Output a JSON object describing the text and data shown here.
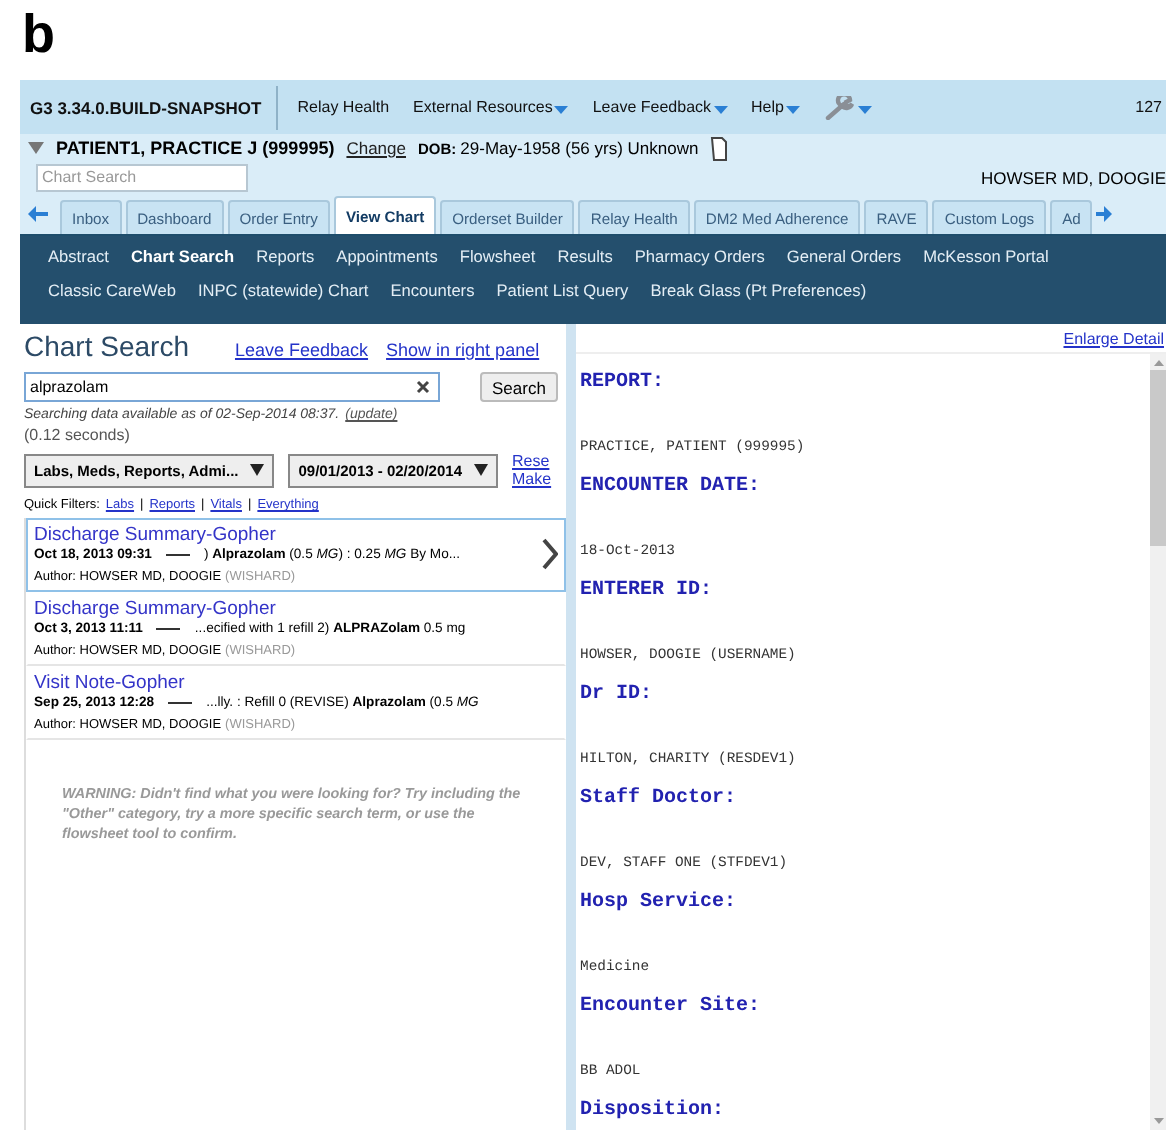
{
  "figure_label": "b",
  "toolbar": {
    "version": "G3 3.34.0.BUILD-SNAPSHOT",
    "menus": [
      {
        "label": "Relay Health",
        "dropdown": false
      },
      {
        "label": "External Resources",
        "dropdown": true
      },
      {
        "label": "Leave Feedback",
        "dropdown": true
      },
      {
        "label": "Help",
        "dropdown": true
      }
    ],
    "right_text": "127"
  },
  "patient": {
    "name": "PATIENT1, PRACTICE J (999995)",
    "change_link": "Change",
    "dob_label": "DOB:",
    "dob": "29-May-1958 (56 yrs) Unknown",
    "chart_search_placeholder": "Chart Search",
    "provider": "HOWSER MD, DOOGIE"
  },
  "tabs": [
    {
      "label": "Inbox",
      "selected": false
    },
    {
      "label": "Dashboard",
      "selected": false
    },
    {
      "label": "Order Entry",
      "selected": false
    },
    {
      "label": "View Chart",
      "selected": true
    },
    {
      "label": "Orderset Builder",
      "selected": false
    },
    {
      "label": "Relay Health",
      "selected": false
    },
    {
      "label": "DM2 Med Adherence",
      "selected": false
    },
    {
      "label": "RAVE",
      "selected": false
    },
    {
      "label": "Custom Logs",
      "selected": false
    },
    {
      "label": "Ad",
      "selected": false
    }
  ],
  "nav_rows": [
    [
      {
        "label": "Abstract",
        "selected": false
      },
      {
        "label": "Chart Search",
        "selected": true
      },
      {
        "label": "Reports",
        "selected": false
      },
      {
        "label": "Appointments",
        "selected": false
      },
      {
        "label": "Flowsheet",
        "selected": false
      },
      {
        "label": "Results",
        "selected": false
      },
      {
        "label": "Pharmacy Orders",
        "selected": false
      },
      {
        "label": "General Orders",
        "selected": false
      },
      {
        "label": "McKesson Portal",
        "selected": false
      }
    ],
    [
      {
        "label": "Classic CareWeb",
        "selected": false
      },
      {
        "label": "INPC (statewide) Chart",
        "selected": false
      },
      {
        "label": "Encounters",
        "selected": false
      },
      {
        "label": "Patient List Query",
        "selected": false
      },
      {
        "label": "Break Glass (Pt Preferences)",
        "selected": false
      }
    ]
  ],
  "search_panel": {
    "title": "Chart Search",
    "links": [
      "Leave Feedback",
      "Show in right panel"
    ],
    "query": "alprazolam",
    "search_button": "Search",
    "status": "Searching data available as of 02-Sep-2014 08:37.",
    "update_link": "(update)",
    "timing": "(0.12 seconds)",
    "dropdowns": [
      "Labs, Meds, Reports, Admi...",
      "09/01/2013 - 02/20/2014"
    ],
    "side_links": [
      "Rese",
      "Make"
    ],
    "quick_filters_label": "Quick Filters:",
    "quick_filter_separator": "|",
    "quick_filters": [
      "Labs",
      "Reports",
      "Vitals",
      "Everything"
    ],
    "results": [
      {
        "title": "Discharge Summary-Gopher",
        "date": "Oct 18, 2013 09:31",
        "snippet": ") **Alprazolam** (0.5 *MG*) : 0.25 *MG* By Mo...",
        "author": "Author: HOWSER MD, DOOGIE",
        "site": "(WISHARD)",
        "selected": true
      },
      {
        "title": "Discharge Summary-Gopher",
        "date": "Oct 3, 2013 11:11",
        "snippet": "...ecified with 1 refill 2) **ALPRAZolam** 0.5 mg",
        "author": "Author: HOWSER MD, DOOGIE",
        "site": "(WISHARD)",
        "selected": false
      },
      {
        "title": "Visit Note-Gopher",
        "date": "Sep 25, 2013 12:28",
        "snippet": "...lly. : Refill 0 (REVISE) **Alprazolam** (0.5 *MG*",
        "author": "Author: HOWSER MD, DOOGIE",
        "site": "(WISHARD)",
        "selected": false
      }
    ],
    "warning": "WARNING: Didn't find what you were looking for? Try including the \"Other\" category, try a more specific search term, or use the flowsheet tool to confirm."
  },
  "detail_panel": {
    "enlarge_link": "Enlarge Detail",
    "fields": [
      {
        "heading": "REPORT:",
        "value": "PRACTICE, PATIENT (999995)"
      },
      {
        "heading": "ENCOUNTER DATE:",
        "value": "18-Oct-2013"
      },
      {
        "heading": "ENTERER ID:",
        "value": "HOWSER, DOOGIE (USERNAME)"
      },
      {
        "heading": "Dr ID:",
        "value": "HILTON, CHARITY (RESDEV1)"
      },
      {
        "heading": "Staff Doctor:",
        "value": "DEV, STAFF ONE (STFDEV1)"
      },
      {
        "heading": "Hosp Service:",
        "value": "Medicine"
      },
      {
        "heading": "Encounter Site:",
        "value": "BB ADOL"
      },
      {
        "heading": "Disposition:"
      }
    ]
  }
}
